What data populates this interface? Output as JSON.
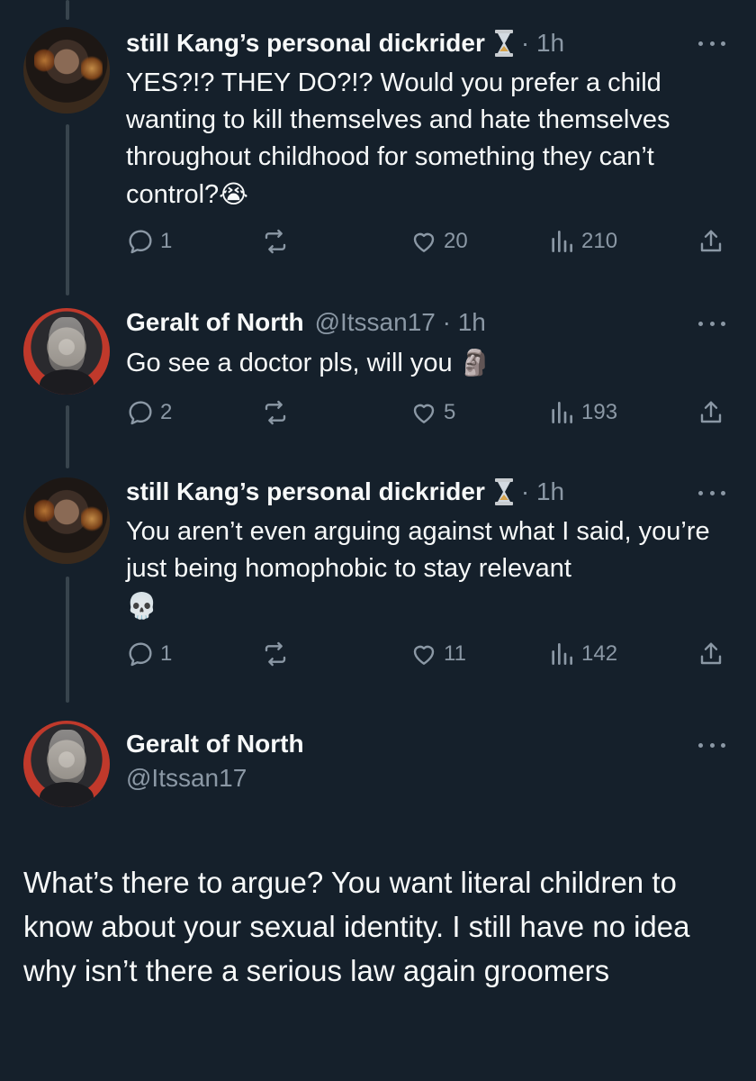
{
  "tweets": [
    {
      "name": "still Kang’s personal dickrider",
      "meta": "· 1h",
      "text": "YES?!? THEY DO?!? Would you prefer a child wanting to kill themselves and hate themselves throughout childhood for something they can’t control?",
      "emoji": "😭",
      "replies": "1",
      "likes": "20",
      "views": "210"
    },
    {
      "name": "Geralt of North",
      "meta": "@Itssan17 · 1h",
      "text": "Go see a doctor pls, will you",
      "emoji": "🗿",
      "replies": "2",
      "likes": "5",
      "views": "193"
    },
    {
      "name": "still Kang’s personal dickrider",
      "meta": "· 1h",
      "text": "You aren’t even arguing against what I said, you’re just being homophobic to stay relevant",
      "emoji": "💀",
      "replies": "1",
      "likes": "11",
      "views": "142"
    }
  ],
  "main_tweet": {
    "name": "Geralt of North",
    "handle": "@Itssan17",
    "text": "What’s there to argue? You want literal children to know about your sexual identity. I still have no idea why isn’t there a serious law again groomers"
  },
  "icons": [
    "reply-icon",
    "retweet-icon",
    "like-icon",
    "views-icon",
    "share-icon",
    "more-icon",
    "hourglass-icon"
  ],
  "colors": {
    "background": "#15202b",
    "text": "#f7f9f9",
    "secondary": "#8b98a5",
    "thread_line": "#38444d"
  }
}
